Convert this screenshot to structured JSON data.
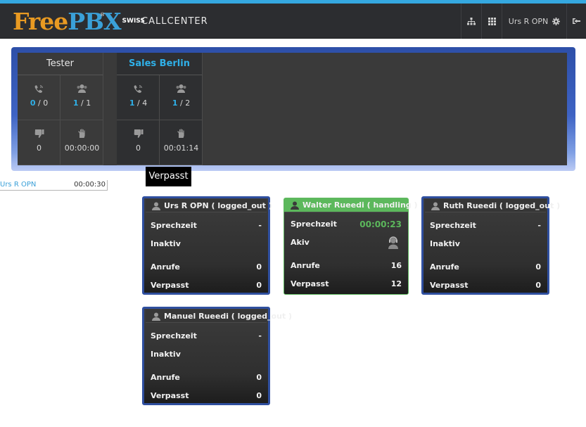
{
  "navbar": {
    "logo_free": "Free",
    "logo_pbx": "PBX",
    "logo_reg": "®",
    "logo_swiss": "SWISS",
    "title": "CALLCENTER",
    "user_label": "Urs R OPN",
    "icons": [
      "sitemap-icon",
      "grid-icon",
      "gear-icon",
      "logout-icon"
    ]
  },
  "queues": [
    {
      "name": "Tester",
      "calls_active": "0",
      "calls_total": "0",
      "agents_active": "1",
      "agents_total": "1",
      "missed": "0",
      "wait_time": "00:00:00"
    },
    {
      "name": "Sales Berlin",
      "calls_active": "1",
      "calls_total": "4",
      "agents_active": "1",
      "agents_total": "2",
      "missed": "0",
      "wait_time": "00:01:14"
    }
  ],
  "tooltip": "Verpasst",
  "sep": "/",
  "current_user": {
    "name": "Urs R OPN",
    "time": "00:00:30"
  },
  "labels": {
    "talk_time": "Sprechzeit",
    "calls": "Anrufe",
    "missed": "Verpasst"
  },
  "agents": [
    {
      "name": "Urs R OPN ( logged_out )",
      "talk_time": "-",
      "status": "Inaktiv",
      "calls": "0",
      "missed": "0"
    },
    {
      "name": "Walter Rueedi ( handling )",
      "talk_time": "00:00:23",
      "status": "Akiv",
      "calls": "16",
      "missed": "12"
    },
    {
      "name": "Ruth Rueedi ( logged_out )",
      "talk_time": "-",
      "status": "Inaktiv",
      "calls": "0",
      "missed": "0"
    },
    {
      "name": "Manuel Rueedi ( logged_out )",
      "talk_time": "-",
      "status": "Inaktiv",
      "calls": "0",
      "missed": "0"
    }
  ],
  "colors": {
    "accent_blue": "#2fb0e8",
    "missed_red": "#e53a2f",
    "wait_orange": "#f1a33a",
    "handling_green": "#5cb85c",
    "hero_border": "#2f4f9f"
  }
}
